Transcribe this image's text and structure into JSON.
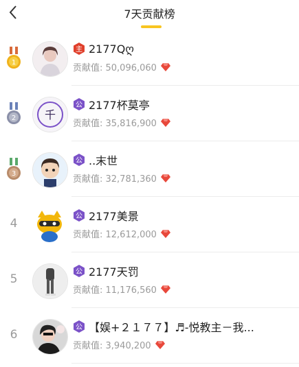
{
  "header": {
    "title": "7天贡献榜",
    "back_icon": "chevron-left-icon",
    "accent": "#f8c520"
  },
  "colors": {
    "gold": "#f0b21c",
    "silver": "#8a8fa8",
    "bronze": "#b88b6a",
    "owner_badge": "#e0402c",
    "member_badge": "#7b52c8",
    "gem": "#e8483b"
  },
  "rows": [
    {
      "rank": "1",
      "role": "主",
      "name": "2177Qღ",
      "contrib": "贡献值: 50,096,060"
    },
    {
      "rank": "2",
      "role": "公",
      "name": "2177杯莫亭",
      "contrib": "贡献值: 35,816,900"
    },
    {
      "rank": "3",
      "role": "公",
      "name": "..末世",
      "contrib": "贡献值: 32,781,360"
    },
    {
      "rank": "4",
      "role": "公",
      "name": "2177美景",
      "contrib": "贡献值: 12,612,000"
    },
    {
      "rank": "5",
      "role": "公",
      "name": "2177天罚",
      "contrib": "贡献值: 11,176,560"
    },
    {
      "rank": "6",
      "role": "公",
      "name": "【娱+２１７７】♬-悦教主－我...",
      "contrib": "贡献值: 3,940,200"
    }
  ]
}
